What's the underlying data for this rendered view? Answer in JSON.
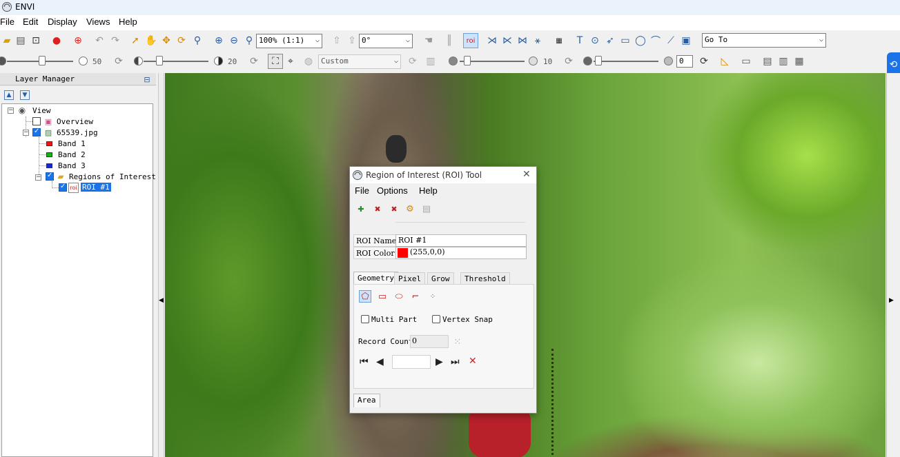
{
  "app": {
    "title": "ENVI"
  },
  "menu": [
    "File",
    "Edit",
    "Display",
    "Views",
    "Help"
  ],
  "toolbar1": {
    "zoom_value": "100% (1:1)",
    "rotation_value": "0°",
    "goto_value": "Go To"
  },
  "toolbar2": {
    "brightness_value": "50",
    "contrast_value": "20",
    "stretch_value": "Custom",
    "sharpen_value": "10",
    "transparency_value": "0"
  },
  "layer_manager": {
    "title": "Layer Manager",
    "tree": {
      "view": "View",
      "overview": "Overview",
      "image": "65539.jpg",
      "bands": [
        {
          "label": "Band 1",
          "color": "#e81818"
        },
        {
          "label": "Band 2",
          "color": "#18b018"
        },
        {
          "label": "Band 3",
          "color": "#1828d0"
        }
      ],
      "roi_folder": "Regions of Interest",
      "roi_item": "ROI #1"
    }
  },
  "roi_dialog": {
    "title": "Region of Interest (ROI) Tool",
    "menu": [
      "File",
      "Options",
      "Help"
    ],
    "roi_name_label": "ROI Name",
    "roi_name_value": "ROI #1",
    "roi_color_label": "ROI Color",
    "roi_color_value": "(255,0,0)",
    "roi_color_swatch": "#ff0000",
    "tabs": [
      "Geometry",
      "Pixel",
      "Grow",
      "Threshold"
    ],
    "active_tab": "Geometry",
    "multi_part_label": "Multi Part",
    "vertex_snap_label": "Vertex Snap",
    "record_count_label": "Record Count",
    "record_count_value": "0",
    "bottom_tab": "Area"
  },
  "colors": {
    "selection": "#1a73e8",
    "accent_blue": "#2a5d9f"
  }
}
